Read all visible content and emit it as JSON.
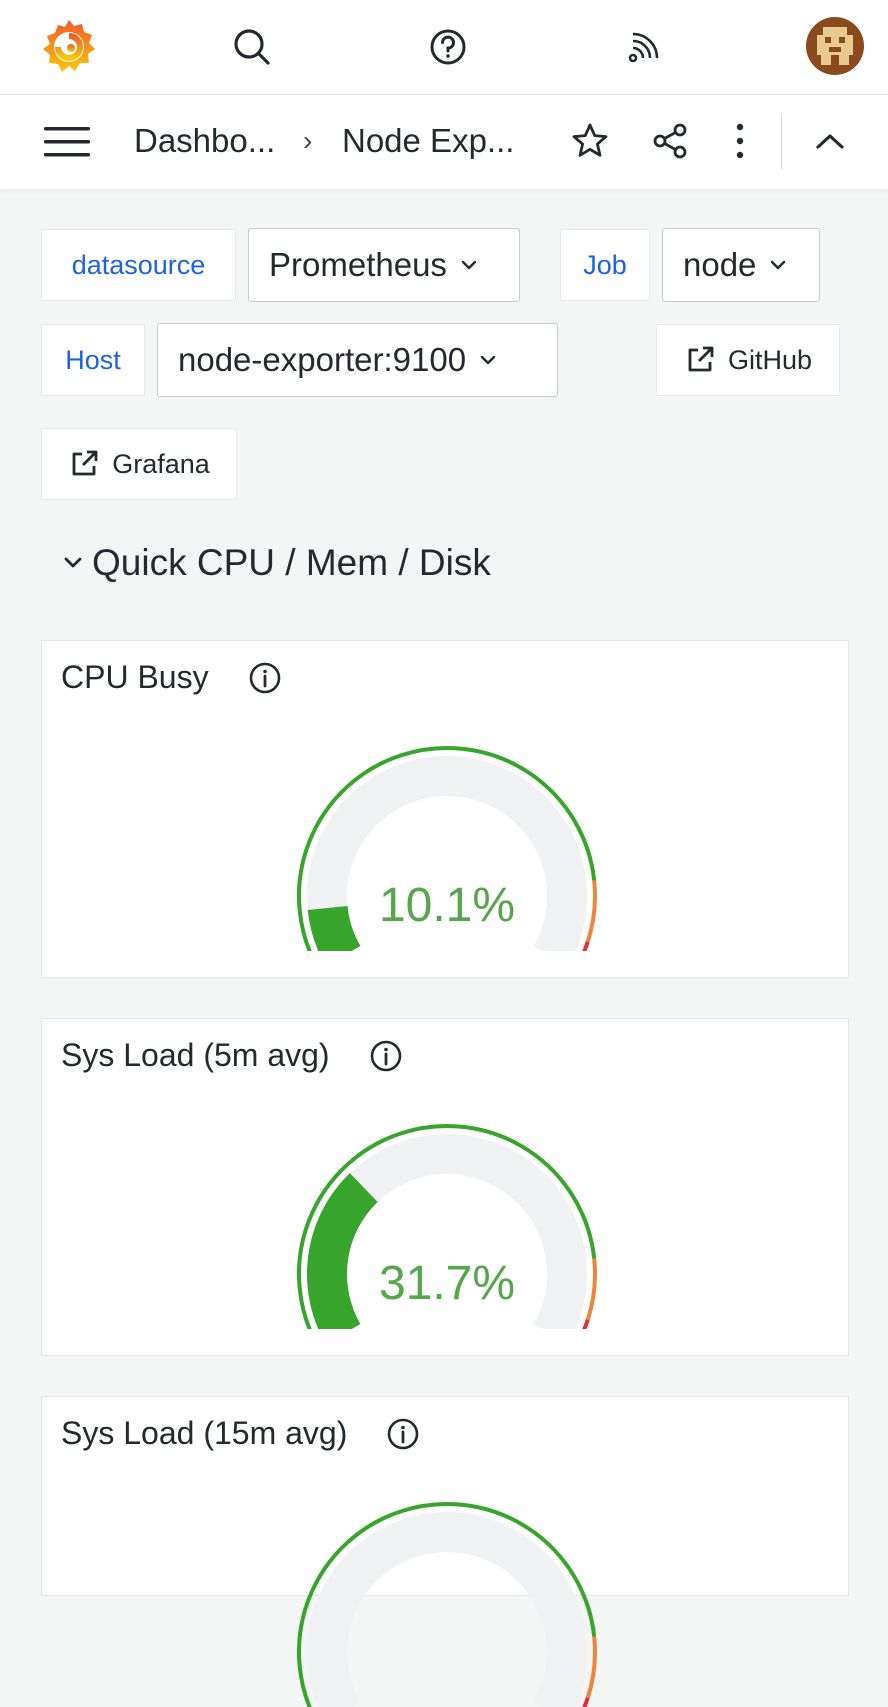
{
  "topbar": {
    "logo_icon": "grafana-logo-icon",
    "search_icon": "search-icon",
    "help_icon": "help-icon",
    "news_icon": "rss-feed-icon",
    "avatar_icon": "user-avatar"
  },
  "navbar": {
    "menu_icon": "hamburger-menu-icon",
    "breadcrumb_1": "Dashbo...",
    "breadcrumb_sep": "›",
    "breadcrumb_2": "Node Exp...",
    "star_icon": "star-icon",
    "share_icon": "share-icon",
    "more_icon": "kebab-menu-icon",
    "collapse_icon": "chevron-up-icon"
  },
  "variables": {
    "datasource_label": "datasource",
    "datasource_value": "Prometheus",
    "job_label": "Job",
    "job_value": "node",
    "host_label": "Host",
    "host_value": "node-exporter:9100"
  },
  "links": {
    "github": "GitHub",
    "grafana": "Grafana"
  },
  "row": {
    "title": "Quick CPU / Mem / Disk"
  },
  "panels": [
    {
      "title": "CPU Busy",
      "value_text": "10.1%",
      "value": 10.1
    },
    {
      "title": "Sys Load (5m avg)",
      "value_text": "31.7%",
      "value": 31.7
    },
    {
      "title": "Sys Load (15m avg)",
      "value_text": "",
      "value": null
    }
  ],
  "colors": {
    "accent_link": "#1f62e0",
    "gauge_green": "#37a52b",
    "gauge_text": "#56a64b",
    "threshold_orange": "#ef843c",
    "threshold_red": "#e02f44",
    "gauge_track": "#eff1f2"
  }
}
